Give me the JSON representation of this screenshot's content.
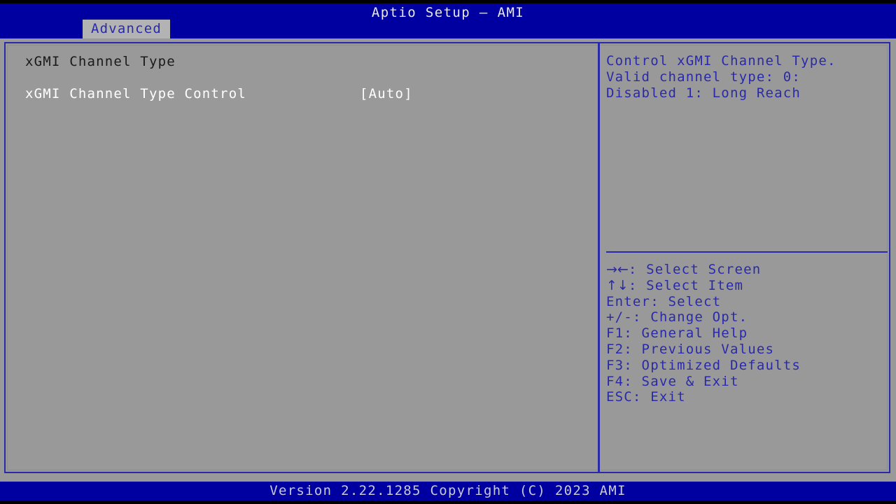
{
  "header": {
    "title": "Aptio Setup – AMI",
    "tabs": [
      {
        "label": "Advanced",
        "active": true
      }
    ]
  },
  "colors": {
    "header_blue": "#0000a0",
    "body_gray": "#999999",
    "accent_blue": "#2a2aa8",
    "tab_active_bg": "#b3b3b3",
    "heading_text": "#1a1a1a",
    "option_text": "#ffffff",
    "footer_text": "#c8c8d8"
  },
  "settings": {
    "rows": [
      {
        "label": "xGMI Channel Type",
        "value": "",
        "kind": "heading",
        "selected": false
      },
      {
        "label": "xGMI Channel Type Control",
        "value": "[Auto]",
        "kind": "option",
        "selected": false
      }
    ]
  },
  "help": {
    "lines": [
      "Control xGMI Channel Type.",
      "Valid channel type: 0:",
      "Disabled 1: Long Reach"
    ]
  },
  "key_legend": {
    "items": [
      {
        "glyph": "→←",
        "text": ": Select Screen"
      },
      {
        "glyph": "↑↓",
        "text": ": Select Item"
      },
      {
        "glyph": "",
        "text": "Enter: Select"
      },
      {
        "glyph": "",
        "text": "+/-: Change Opt."
      },
      {
        "glyph": "",
        "text": "F1: General Help"
      },
      {
        "glyph": "",
        "text": "F2: Previous Values"
      },
      {
        "glyph": "",
        "text": "F3: Optimized Defaults"
      },
      {
        "glyph": "",
        "text": "F4: Save & Exit"
      },
      {
        "glyph": "",
        "text": "ESC: Exit"
      }
    ]
  },
  "footer": {
    "version_text": "Version 2.22.1285 Copyright (C) 2023 AMI"
  }
}
